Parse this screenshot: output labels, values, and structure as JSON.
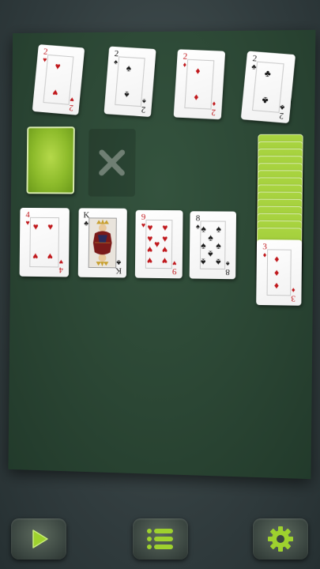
{
  "foundations": [
    {
      "rank": "2",
      "suit": "♥",
      "color": "red",
      "icon": "heart"
    },
    {
      "rank": "2",
      "suit": "♠",
      "color": "black",
      "icon": "spade"
    },
    {
      "rank": "2",
      "suit": "♦",
      "color": "red",
      "icon": "diamond"
    },
    {
      "rank": "2",
      "suit": "♣",
      "color": "black",
      "icon": "club"
    }
  ],
  "tableau": [
    {
      "rank": "4",
      "suit": "♥",
      "color": "red",
      "icon": "heart"
    },
    {
      "rank": "K",
      "suit": "♣",
      "color": "black",
      "icon": "club"
    },
    {
      "rank": "9",
      "suit": "♥",
      "color": "red",
      "icon": "heart"
    },
    {
      "rank": "8",
      "suit": "♠",
      "color": "black",
      "icon": "spade"
    }
  ],
  "waste_top": {
    "rank": "3",
    "suit": "♦",
    "color": "red",
    "icon": "diamond"
  },
  "stock_count": 14,
  "empty_slot_icon": "x-mark",
  "toolbar": {
    "play_icon": "play-icon",
    "menu_icon": "menu-list-icon",
    "settings_icon": "gear-icon"
  },
  "colors": {
    "felt": "#2b4634",
    "card_back": "#8dbb2b",
    "accent_green": "#9ed12e",
    "red_suit": "#c0181c",
    "black_suit": "#1b1b1b"
  }
}
